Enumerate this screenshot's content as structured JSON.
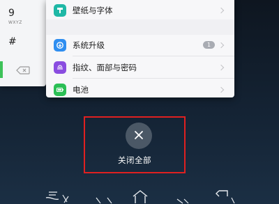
{
  "dialer": {
    "digit_9": "9",
    "letters_9": "WXYZ",
    "hash": "#"
  },
  "settings": {
    "items": [
      {
        "label": "壁纸与字体",
        "icon": "theme-icon",
        "color": "#1fb8a6"
      },
      {
        "label": "系统升级",
        "icon": "system-update-icon",
        "color": "#2f8ef0",
        "badge": "1"
      },
      {
        "label": "指纹、面部与密码",
        "icon": "fingerprint-icon",
        "color": "#8a4de0"
      },
      {
        "label": "电池",
        "icon": "battery-icon",
        "color": "#2bbf55"
      }
    ]
  },
  "recents": {
    "close_all_label": "关闭全部",
    "close_icon": "close-icon"
  },
  "colors": {
    "highlight": "#e02020",
    "background": "#142334"
  }
}
